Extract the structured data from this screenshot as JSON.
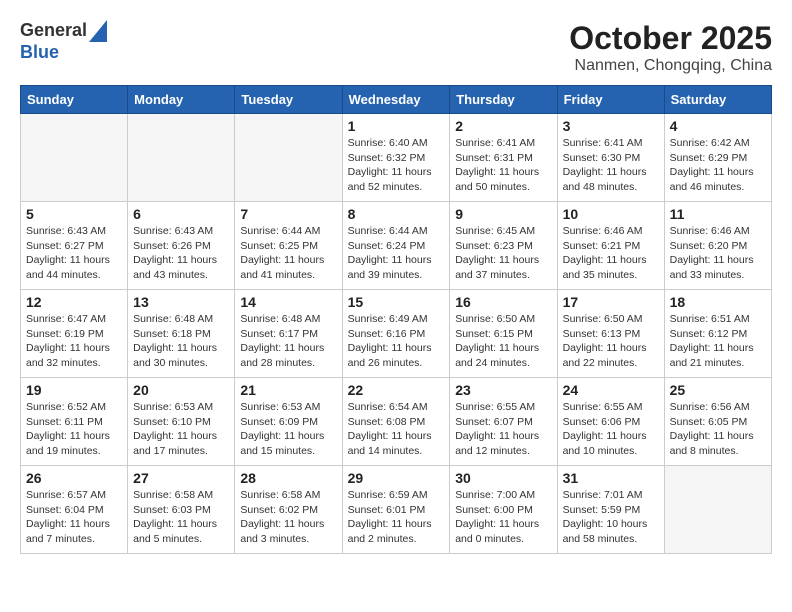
{
  "header": {
    "logo_line1": "General",
    "logo_line2": "Blue",
    "month_title": "October 2025",
    "location": "Nanmen, Chongqing, China"
  },
  "days_of_week": [
    "Sunday",
    "Monday",
    "Tuesday",
    "Wednesday",
    "Thursday",
    "Friday",
    "Saturday"
  ],
  "weeks": [
    [
      {
        "day": "",
        "info": ""
      },
      {
        "day": "",
        "info": ""
      },
      {
        "day": "",
        "info": ""
      },
      {
        "day": "1",
        "info": "Sunrise: 6:40 AM\nSunset: 6:32 PM\nDaylight: 11 hours\nand 52 minutes."
      },
      {
        "day": "2",
        "info": "Sunrise: 6:41 AM\nSunset: 6:31 PM\nDaylight: 11 hours\nand 50 minutes."
      },
      {
        "day": "3",
        "info": "Sunrise: 6:41 AM\nSunset: 6:30 PM\nDaylight: 11 hours\nand 48 minutes."
      },
      {
        "day": "4",
        "info": "Sunrise: 6:42 AM\nSunset: 6:29 PM\nDaylight: 11 hours\nand 46 minutes."
      }
    ],
    [
      {
        "day": "5",
        "info": "Sunrise: 6:43 AM\nSunset: 6:27 PM\nDaylight: 11 hours\nand 44 minutes."
      },
      {
        "day": "6",
        "info": "Sunrise: 6:43 AM\nSunset: 6:26 PM\nDaylight: 11 hours\nand 43 minutes."
      },
      {
        "day": "7",
        "info": "Sunrise: 6:44 AM\nSunset: 6:25 PM\nDaylight: 11 hours\nand 41 minutes."
      },
      {
        "day": "8",
        "info": "Sunrise: 6:44 AM\nSunset: 6:24 PM\nDaylight: 11 hours\nand 39 minutes."
      },
      {
        "day": "9",
        "info": "Sunrise: 6:45 AM\nSunset: 6:23 PM\nDaylight: 11 hours\nand 37 minutes."
      },
      {
        "day": "10",
        "info": "Sunrise: 6:46 AM\nSunset: 6:21 PM\nDaylight: 11 hours\nand 35 minutes."
      },
      {
        "day": "11",
        "info": "Sunrise: 6:46 AM\nSunset: 6:20 PM\nDaylight: 11 hours\nand 33 minutes."
      }
    ],
    [
      {
        "day": "12",
        "info": "Sunrise: 6:47 AM\nSunset: 6:19 PM\nDaylight: 11 hours\nand 32 minutes."
      },
      {
        "day": "13",
        "info": "Sunrise: 6:48 AM\nSunset: 6:18 PM\nDaylight: 11 hours\nand 30 minutes."
      },
      {
        "day": "14",
        "info": "Sunrise: 6:48 AM\nSunset: 6:17 PM\nDaylight: 11 hours\nand 28 minutes."
      },
      {
        "day": "15",
        "info": "Sunrise: 6:49 AM\nSunset: 6:16 PM\nDaylight: 11 hours\nand 26 minutes."
      },
      {
        "day": "16",
        "info": "Sunrise: 6:50 AM\nSunset: 6:15 PM\nDaylight: 11 hours\nand 24 minutes."
      },
      {
        "day": "17",
        "info": "Sunrise: 6:50 AM\nSunset: 6:13 PM\nDaylight: 11 hours\nand 22 minutes."
      },
      {
        "day": "18",
        "info": "Sunrise: 6:51 AM\nSunset: 6:12 PM\nDaylight: 11 hours\nand 21 minutes."
      }
    ],
    [
      {
        "day": "19",
        "info": "Sunrise: 6:52 AM\nSunset: 6:11 PM\nDaylight: 11 hours\nand 19 minutes."
      },
      {
        "day": "20",
        "info": "Sunrise: 6:53 AM\nSunset: 6:10 PM\nDaylight: 11 hours\nand 17 minutes."
      },
      {
        "day": "21",
        "info": "Sunrise: 6:53 AM\nSunset: 6:09 PM\nDaylight: 11 hours\nand 15 minutes."
      },
      {
        "day": "22",
        "info": "Sunrise: 6:54 AM\nSunset: 6:08 PM\nDaylight: 11 hours\nand 14 minutes."
      },
      {
        "day": "23",
        "info": "Sunrise: 6:55 AM\nSunset: 6:07 PM\nDaylight: 11 hours\nand 12 minutes."
      },
      {
        "day": "24",
        "info": "Sunrise: 6:55 AM\nSunset: 6:06 PM\nDaylight: 11 hours\nand 10 minutes."
      },
      {
        "day": "25",
        "info": "Sunrise: 6:56 AM\nSunset: 6:05 PM\nDaylight: 11 hours\nand 8 minutes."
      }
    ],
    [
      {
        "day": "26",
        "info": "Sunrise: 6:57 AM\nSunset: 6:04 PM\nDaylight: 11 hours\nand 7 minutes."
      },
      {
        "day": "27",
        "info": "Sunrise: 6:58 AM\nSunset: 6:03 PM\nDaylight: 11 hours\nand 5 minutes."
      },
      {
        "day": "28",
        "info": "Sunrise: 6:58 AM\nSunset: 6:02 PM\nDaylight: 11 hours\nand 3 minutes."
      },
      {
        "day": "29",
        "info": "Sunrise: 6:59 AM\nSunset: 6:01 PM\nDaylight: 11 hours\nand 2 minutes."
      },
      {
        "day": "30",
        "info": "Sunrise: 7:00 AM\nSunset: 6:00 PM\nDaylight: 11 hours\nand 0 minutes."
      },
      {
        "day": "31",
        "info": "Sunrise: 7:01 AM\nSunset: 5:59 PM\nDaylight: 10 hours\nand 58 minutes."
      },
      {
        "day": "",
        "info": ""
      }
    ]
  ]
}
